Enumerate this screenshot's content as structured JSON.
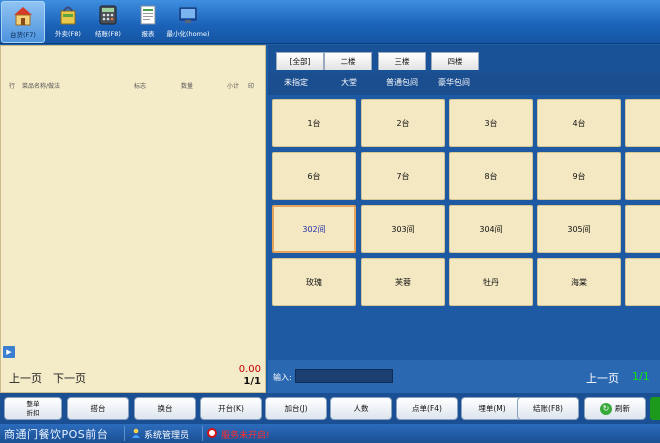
{
  "toolbar": {
    "items": [
      {
        "label": "台货(F7)",
        "icon": "house-icon",
        "active": true
      },
      {
        "label": "外卖(F8)",
        "icon": "bag-icon",
        "active": false
      },
      {
        "label": "结账(F8)",
        "icon": "calculator-icon",
        "active": false
      },
      {
        "label": "报表",
        "icon": "report-icon",
        "active": false
      },
      {
        "label": "最小化(home)",
        "icon": "minimize-icon",
        "active": false
      }
    ]
  },
  "order": {
    "columns": [
      "行",
      "菜品名称/做法",
      "标志",
      "数量",
      "小计",
      "印"
    ],
    "prev_label": "上一页",
    "next_label": "下一页",
    "total": "0.00",
    "page": "1/1"
  },
  "floors": {
    "tabs": [
      "[全部]",
      "二楼",
      "三楼",
      "四楼"
    ]
  },
  "areas": [
    "未指定",
    "大堂",
    "普通包间",
    "豪华包间"
  ],
  "tables": [
    [
      "1台",
      "2台",
      "3台",
      "4台"
    ],
    [
      "6台",
      "7台",
      "8台",
      "9台"
    ],
    [
      "302间",
      "303间",
      "304间",
      "305间"
    ],
    [
      "玫瑰",
      "芙蓉",
      "牡丹",
      "海棠"
    ]
  ],
  "selected_table": "302间",
  "input": {
    "label": "输入:",
    "value": ""
  },
  "tables_pager": {
    "prev_label": "上一页",
    "page": "1/1"
  },
  "actions": [
    {
      "label_line1": "整单",
      "label_line2": "折扣"
    },
    {
      "label": "搭台"
    },
    {
      "label": "换台"
    },
    {
      "label": "开台(K)"
    },
    {
      "label": "加台(J)"
    },
    {
      "label": "人数"
    },
    {
      "label": "点单(F4)"
    },
    {
      "label": "埋单(M)"
    },
    {
      "label": "结账(F8)"
    },
    {
      "label": "刷新"
    }
  ],
  "status": {
    "app_title": "商通门餐饮POS前台",
    "user": "系统管理员",
    "alert": "服务未开启!"
  },
  "colors": {
    "accent": "#1d5fa6",
    "table_bg": "#f3e8c2",
    "selected_border": "#e6a35a",
    "page_green": "#0ce80c",
    "alert_red": "#ff2d2d"
  }
}
